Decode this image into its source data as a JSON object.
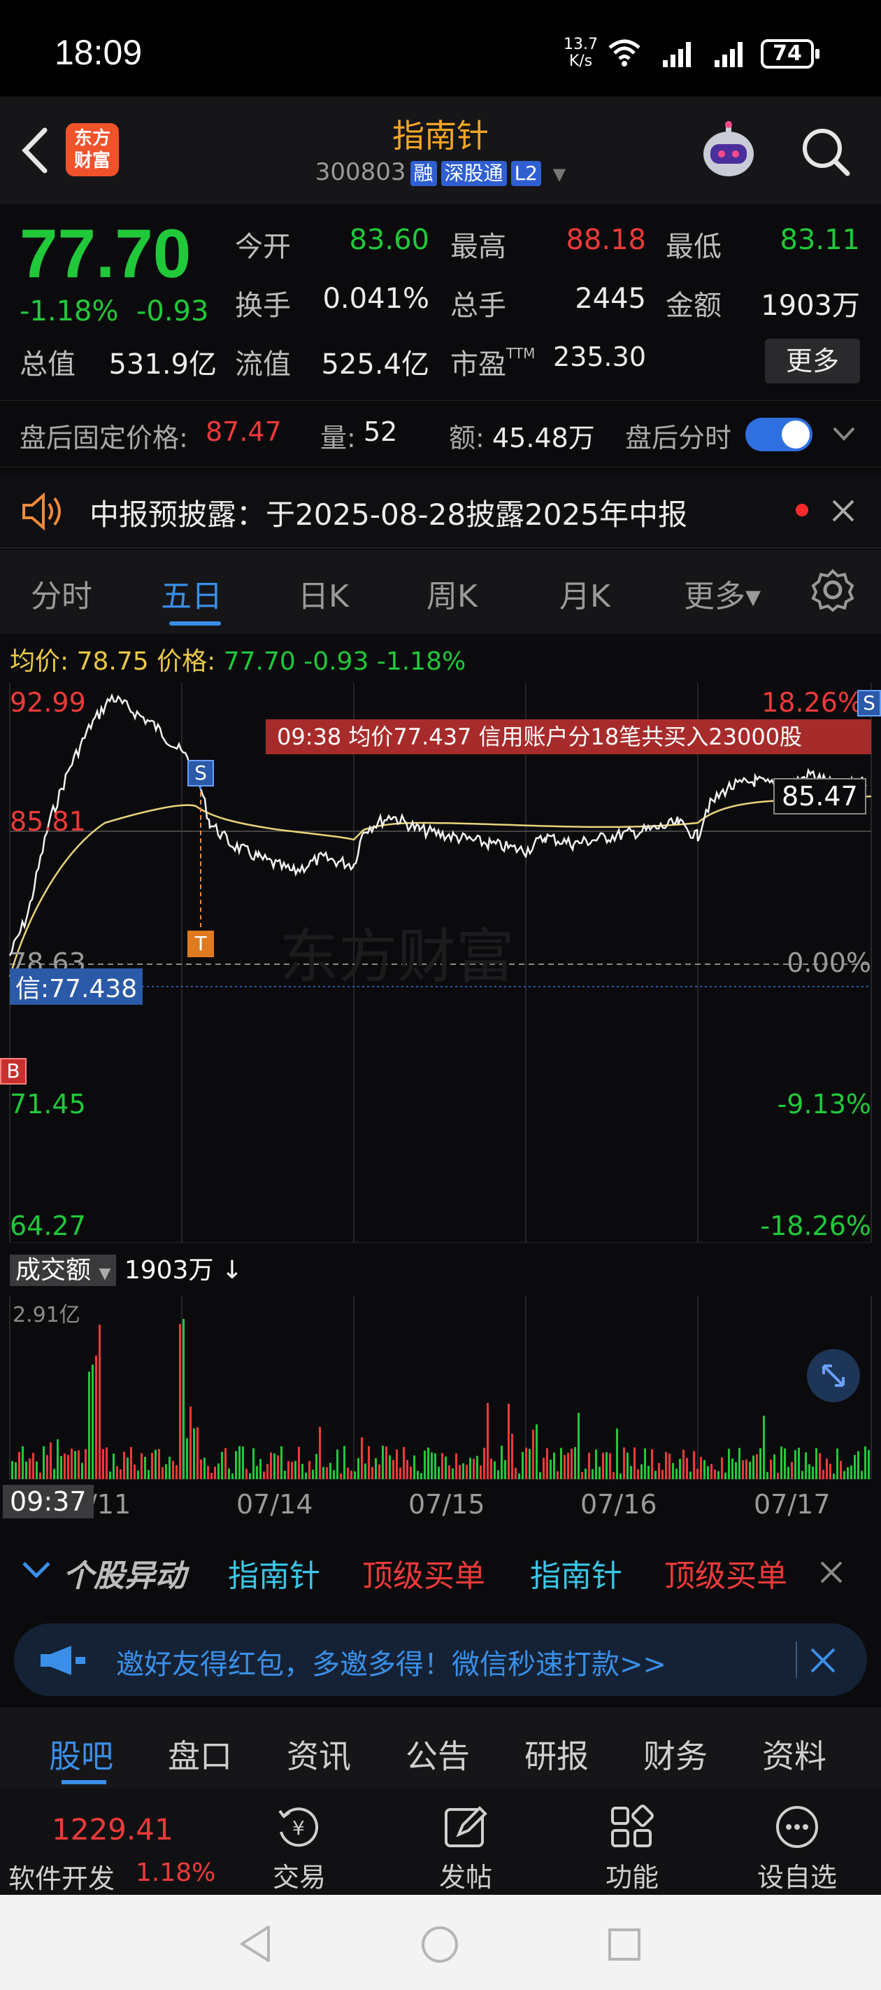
{
  "status_bar": {
    "time": "18:09",
    "net_speed_top": "13.7",
    "net_speed_bottom": "K/s",
    "battery": "74"
  },
  "header": {
    "logo_line1": "东方",
    "logo_line2": "财富",
    "stock_name": "指南针",
    "stock_code": "300803",
    "tags": [
      "融",
      "深股通",
      "L2"
    ]
  },
  "quote": {
    "price": "77.70",
    "change_pct": "-1.18%",
    "change": "-0.93",
    "open_label": "今开",
    "open": "83.60",
    "high_label": "最高",
    "high": "88.18",
    "low_label": "最低",
    "low": "83.11",
    "turnover_label": "换手",
    "turnover": "0.041%",
    "volume_label": "总手",
    "volume": "2445",
    "amount_label": "金额",
    "amount": "1903万",
    "mktcap_label": "总值",
    "mktcap": "531.9亿",
    "float_label": "流值",
    "float": "525.4亿",
    "pe_label": "市盈",
    "pe_sup": "TTM",
    "pe": "235.30",
    "more": "更多"
  },
  "after_hours": {
    "price_label": "盘后固定价格:",
    "price": "87.47",
    "vol_label": "量:",
    "vol": "52",
    "amt_label": "额:",
    "amt": "45.48万",
    "toggle_label": "盘后分时"
  },
  "notice": {
    "text": "中报预披露：于2025-08-28披露2025年中报"
  },
  "chart_tabs": [
    "分时",
    "五日",
    "日K",
    "周K",
    "月K",
    "更多▾"
  ],
  "chart": {
    "avg_label": "均价:",
    "avg": "78.75",
    "price_label": "价格:",
    "price": "77.70",
    "chg": "-0.93",
    "chg_pct": "-1.18%",
    "y_top": "92.99",
    "y_mid_upper": "85.81",
    "y_base": "78.63",
    "y_low1": "71.45",
    "y_low2": "64.27",
    "pct_top": "18.26%",
    "pct_zero": "0.00%",
    "pct_low1": "-9.13%",
    "pct_low2": "-18.26%",
    "price_tag": "85.47",
    "credit_tag": "信:77.438",
    "banner": "09:38  均价77.437  信用账户分18笔共买入23000股",
    "marker_s": "S",
    "marker_t": "T",
    "marker_b": "B",
    "watermark": "东方财富",
    "vol_selector": "成交额",
    "vol_value": "1903万 ↓",
    "vol_max": "2.91亿",
    "time_tag": "09:37",
    "x_labels": [
      "/11",
      "07/14",
      "07/15",
      "07/16",
      "07/17"
    ]
  },
  "ticker": {
    "title": "个股异动",
    "items": [
      "指南针",
      "顶级买单",
      "指南针",
      "顶级买单"
    ]
  },
  "invite": {
    "text": "邀好友得红包，多邀多得！微信秒速打款>>"
  },
  "bottom_tabs": [
    "股吧",
    "盘口",
    "资讯",
    "公告",
    "研报",
    "财务",
    "资料"
  ],
  "actions": {
    "index_value": "1229.41",
    "index_name": "软件开发",
    "index_pct": "1.18%",
    "trade": "交易",
    "post": "发帖",
    "func": "功能",
    "watch": "设自选"
  },
  "colors": {
    "up": "#ee3a3a",
    "down": "#21c93a",
    "accent": "#3a8fe8",
    "brand": "#f5a623"
  }
}
